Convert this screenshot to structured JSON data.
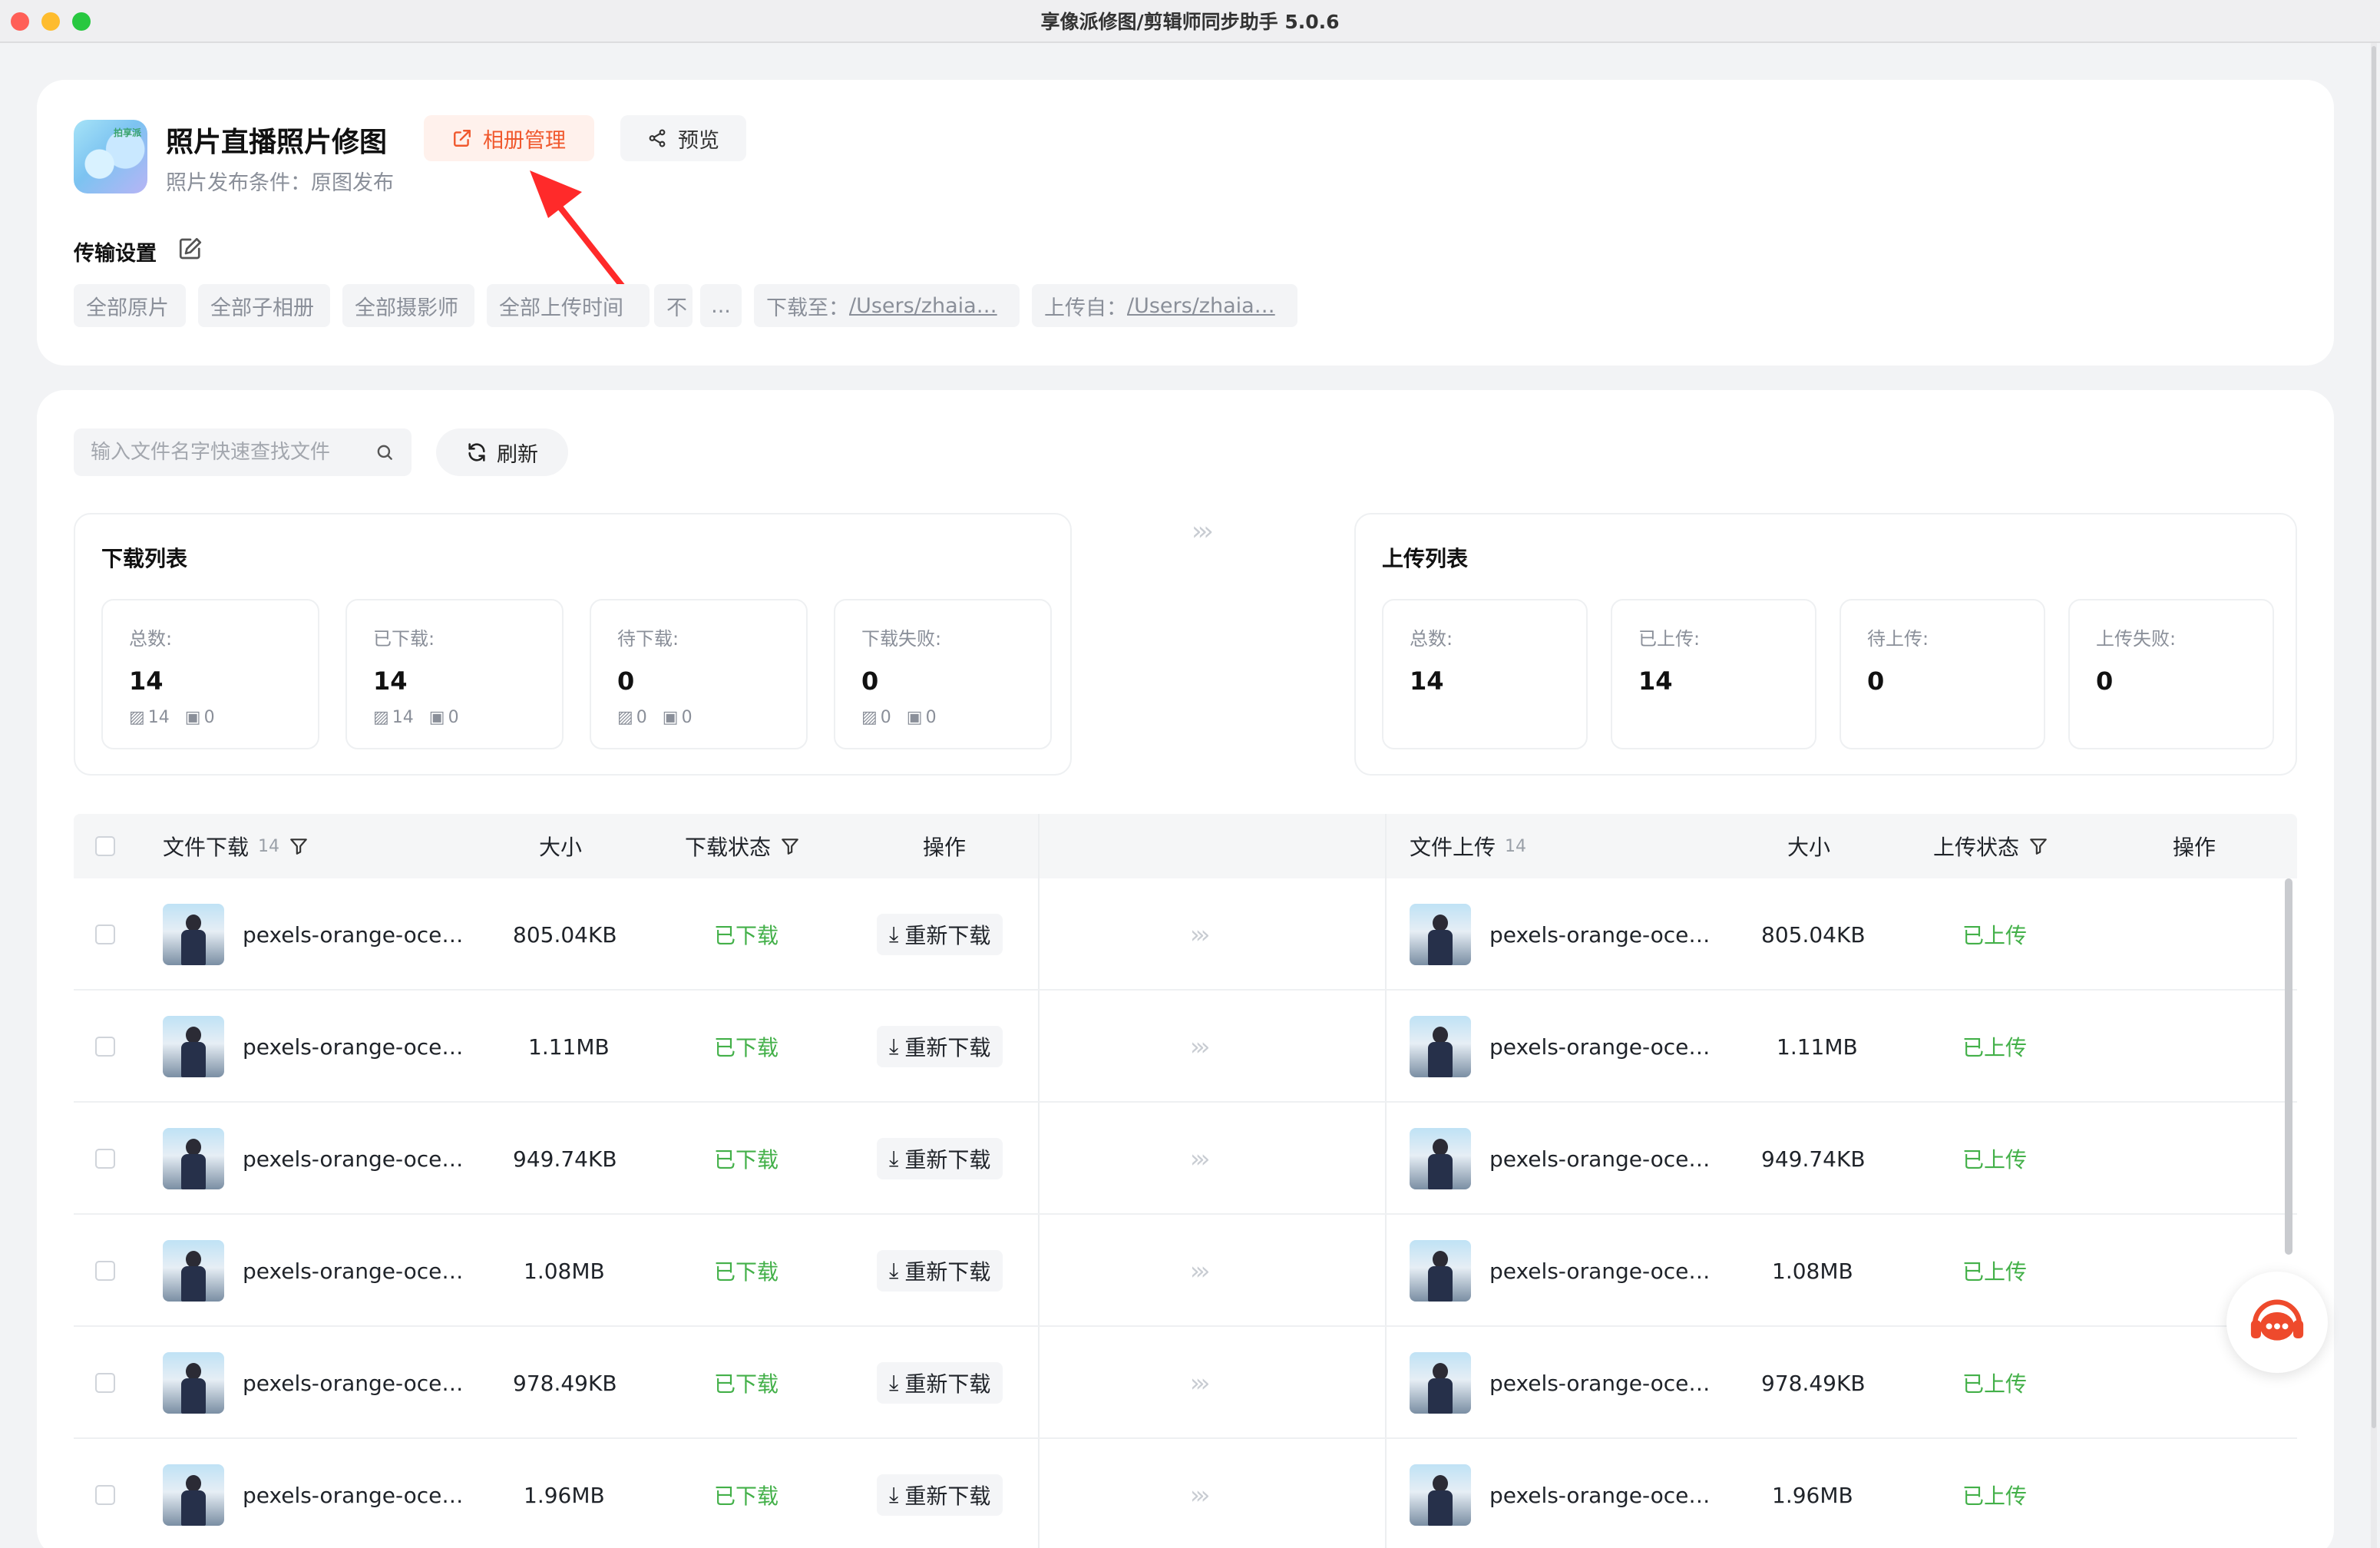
{
  "window": {
    "title": "享像派修图/剪辑师同步助手 5.0.6"
  },
  "header": {
    "logo_mark": "拍享派",
    "title": "照片直播照片修图",
    "subtitle": "照片发布条件：原图发布",
    "album_button": "相册管理",
    "preview_button": "预览"
  },
  "transfer": {
    "label": "传输设置",
    "chips": [
      {
        "text": "全部原片"
      },
      {
        "text": "全部子相册"
      },
      {
        "text": "全部摄影师"
      },
      {
        "text": "全部上传时间"
      },
      {
        "text": "不"
      },
      {
        "text": "..."
      }
    ],
    "download_to_label": "下载至：",
    "download_to_path": "/Users/zhaia…",
    "upload_from_label": "上传自：",
    "upload_from_path": "/Users/zhaia…"
  },
  "toolbar": {
    "search_placeholder": "输入文件名字快速查找文件",
    "refresh_label": "刷新"
  },
  "download_stats": {
    "title": "下载列表",
    "boxes": [
      {
        "label": "总数:",
        "value": "14",
        "img": "14",
        "vid": "0"
      },
      {
        "label": "已下载:",
        "value": "14",
        "img": "14",
        "vid": "0"
      },
      {
        "label": "待下载:",
        "value": "0",
        "img": "0",
        "vid": "0"
      },
      {
        "label": "下载失败:",
        "value": "0",
        "img": "0",
        "vid": "0"
      }
    ]
  },
  "upload_stats": {
    "title": "上传列表",
    "boxes": [
      {
        "label": "总数:",
        "value": "14"
      },
      {
        "label": "已上传:",
        "value": "14"
      },
      {
        "label": "待上传:",
        "value": "0"
      },
      {
        "label": "上传失败:",
        "value": "0"
      }
    ]
  },
  "download_table": {
    "col_file": "文件下载",
    "count": "14",
    "col_size": "大小",
    "col_status": "下载状态",
    "col_action": "操作"
  },
  "upload_table": {
    "col_file": "文件上传",
    "count": "14",
    "col_size": "大小",
    "col_status": "上传状态",
    "col_action": "操作"
  },
  "rows": [
    {
      "dl_name": "pexels-orange-oce…",
      "dl_size": "805.04KB",
      "dl_status": "已下载",
      "action": "重新下载",
      "ul_name": "pexels-orange-oce…",
      "ul_size": "805.04KB",
      "ul_status": "已上传"
    },
    {
      "dl_name": "pexels-orange-oce…",
      "dl_size": "1.11MB",
      "dl_status": "已下载",
      "action": "重新下载",
      "ul_name": "pexels-orange-oce…",
      "ul_size": "1.11MB",
      "ul_status": "已上传"
    },
    {
      "dl_name": "pexels-orange-oce…",
      "dl_size": "949.74KB",
      "dl_status": "已下载",
      "action": "重新下载",
      "ul_name": "pexels-orange-oce…",
      "ul_size": "949.74KB",
      "ul_status": "已上传"
    },
    {
      "dl_name": "pexels-orange-oce…",
      "dl_size": "1.08MB",
      "dl_status": "已下载",
      "action": "重新下载",
      "ul_name": "pexels-orange-oce…",
      "ul_size": "1.08MB",
      "ul_status": "已上传"
    },
    {
      "dl_name": "pexels-orange-oce…",
      "dl_size": "978.49KB",
      "dl_status": "已下载",
      "action": "重新下载",
      "ul_name": "pexels-orange-oce…",
      "ul_size": "978.49KB",
      "ul_status": "已上传"
    },
    {
      "dl_name": "pexels-orange-oce…",
      "dl_size": "1.96MB",
      "dl_status": "已下载",
      "action": "重新下载",
      "ul_name": "pexels-orange-oce…",
      "ul_size": "1.96MB",
      "ul_status": "已上传"
    }
  ],
  "colors": {
    "accent": "#f0582d",
    "success": "#43b049",
    "annotation": "#ff2a2a"
  }
}
